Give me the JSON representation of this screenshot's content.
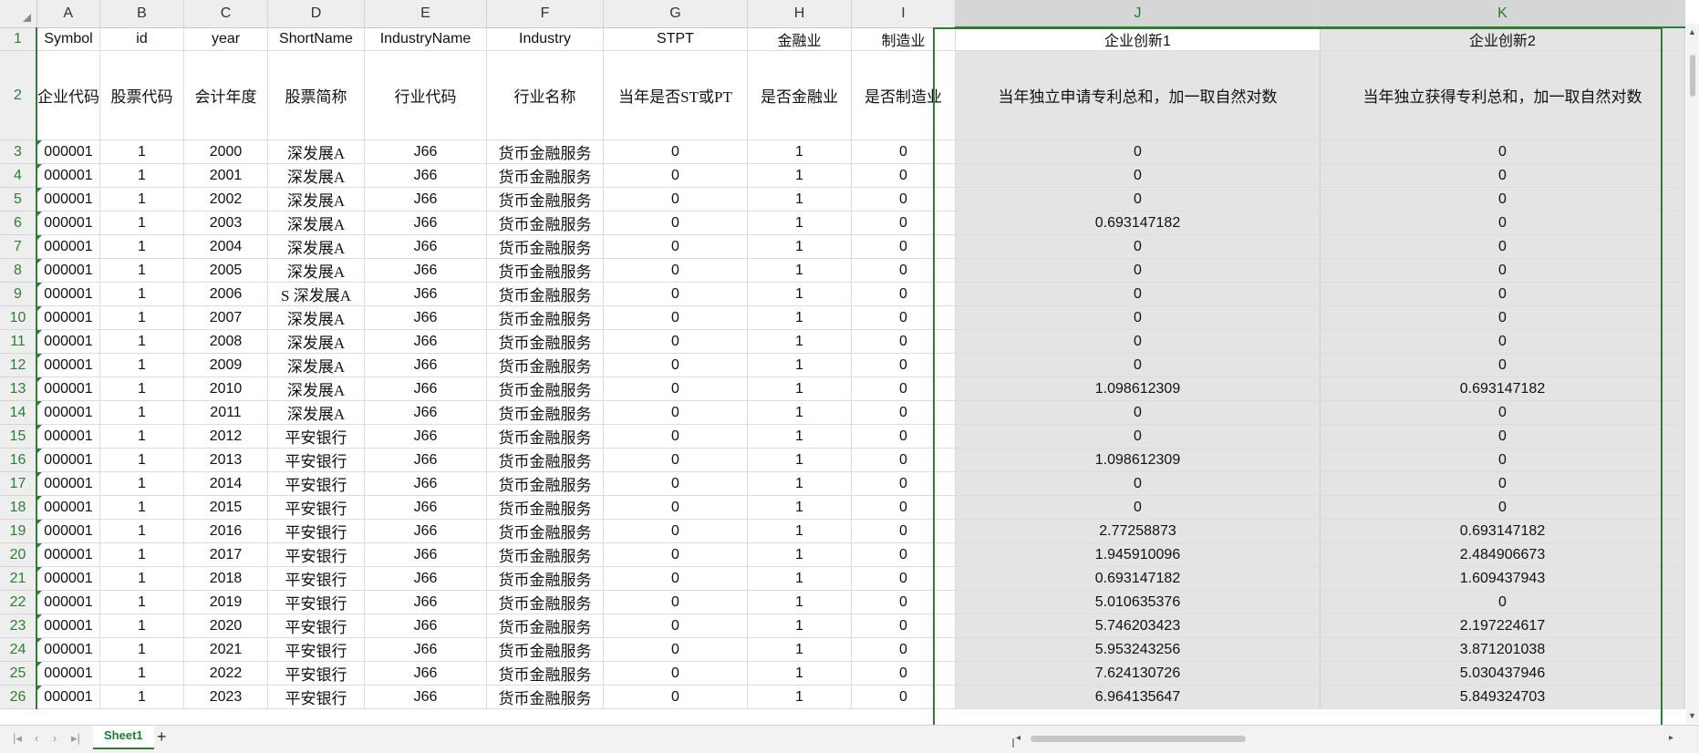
{
  "sheet_tabs": [
    {
      "label": "Sheet1",
      "active": true
    }
  ],
  "add_sheet_label": "+",
  "column_headers": [
    "A",
    "B",
    "C",
    "D",
    "E",
    "F",
    "G",
    "H",
    "I",
    "J",
    "K"
  ],
  "selected_columns": [
    "J",
    "K"
  ],
  "header_row1": [
    "Symbol",
    "id",
    "year",
    "ShortName",
    "IndustryName",
    "Industry",
    "STPT",
    "金融业",
    "制造业",
    "企业创新1",
    "企业创新2"
  ],
  "header_row2": [
    "企业代码",
    "股票代码",
    "会计年度",
    "股票简称",
    "行业代码",
    "行业名称",
    "当年是否ST或PT",
    "是否金融业",
    "是否制造业",
    "当年独立申请专利总和，加一取自然对数",
    "当年独立获得专利总和，加一取自然对数"
  ],
  "rows": [
    [
      "000001",
      "1",
      "2000",
      "深发展A",
      "J66",
      "货币金融服务",
      "0",
      "1",
      "0",
      "0",
      "0"
    ],
    [
      "000001",
      "1",
      "2001",
      "深发展A",
      "J66",
      "货币金融服务",
      "0",
      "1",
      "0",
      "0",
      "0"
    ],
    [
      "000001",
      "1",
      "2002",
      "深发展A",
      "J66",
      "货币金融服务",
      "0",
      "1",
      "0",
      "0",
      "0"
    ],
    [
      "000001",
      "1",
      "2003",
      "深发展A",
      "J66",
      "货币金融服务",
      "0",
      "1",
      "0",
      "0.693147182",
      "0"
    ],
    [
      "000001",
      "1",
      "2004",
      "深发展A",
      "J66",
      "货币金融服务",
      "0",
      "1",
      "0",
      "0",
      "0"
    ],
    [
      "000001",
      "1",
      "2005",
      "深发展A",
      "J66",
      "货币金融服务",
      "0",
      "1",
      "0",
      "0",
      "0"
    ],
    [
      "000001",
      "1",
      "2006",
      "S 深发展A",
      "J66",
      "货币金融服务",
      "0",
      "1",
      "0",
      "0",
      "0"
    ],
    [
      "000001",
      "1",
      "2007",
      "深发展A",
      "J66",
      "货币金融服务",
      "0",
      "1",
      "0",
      "0",
      "0"
    ],
    [
      "000001",
      "1",
      "2008",
      "深发展A",
      "J66",
      "货币金融服务",
      "0",
      "1",
      "0",
      "0",
      "0"
    ],
    [
      "000001",
      "1",
      "2009",
      "深发展A",
      "J66",
      "货币金融服务",
      "0",
      "1",
      "0",
      "0",
      "0"
    ],
    [
      "000001",
      "1",
      "2010",
      "深发展A",
      "J66",
      "货币金融服务",
      "0",
      "1",
      "0",
      "1.098612309",
      "0.693147182"
    ],
    [
      "000001",
      "1",
      "2011",
      "深发展A",
      "J66",
      "货币金融服务",
      "0",
      "1",
      "0",
      "0",
      "0"
    ],
    [
      "000001",
      "1",
      "2012",
      "平安银行",
      "J66",
      "货币金融服务",
      "0",
      "1",
      "0",
      "0",
      "0"
    ],
    [
      "000001",
      "1",
      "2013",
      "平安银行",
      "J66",
      "货币金融服务",
      "0",
      "1",
      "0",
      "1.098612309",
      "0"
    ],
    [
      "000001",
      "1",
      "2014",
      "平安银行",
      "J66",
      "货币金融服务",
      "0",
      "1",
      "0",
      "0",
      "0"
    ],
    [
      "000001",
      "1",
      "2015",
      "平安银行",
      "J66",
      "货币金融服务",
      "0",
      "1",
      "0",
      "0",
      "0"
    ],
    [
      "000001",
      "1",
      "2016",
      "平安银行",
      "J66",
      "货币金融服务",
      "0",
      "1",
      "0",
      "2.77258873",
      "0.693147182"
    ],
    [
      "000001",
      "1",
      "2017",
      "平安银行",
      "J66",
      "货币金融服务",
      "0",
      "1",
      "0",
      "1.945910096",
      "2.484906673"
    ],
    [
      "000001",
      "1",
      "2018",
      "平安银行",
      "J66",
      "货币金融服务",
      "0",
      "1",
      "0",
      "0.693147182",
      "1.609437943"
    ],
    [
      "000001",
      "1",
      "2019",
      "平安银行",
      "J66",
      "货币金融服务",
      "0",
      "1",
      "0",
      "5.010635376",
      "0"
    ],
    [
      "000001",
      "1",
      "2020",
      "平安银行",
      "J66",
      "货币金融服务",
      "0",
      "1",
      "0",
      "5.746203423",
      "2.197224617"
    ],
    [
      "000001",
      "1",
      "2021",
      "平安银行",
      "J66",
      "货币金融服务",
      "0",
      "1",
      "0",
      "5.953243256",
      "3.871201038"
    ],
    [
      "000001",
      "1",
      "2022",
      "平安银行",
      "J66",
      "货币金融服务",
      "0",
      "1",
      "0",
      "7.624130726",
      "5.030437946"
    ],
    [
      "000001",
      "1",
      "2023",
      "平安银行",
      "J66",
      "货币金融服务",
      "0",
      "1",
      "0",
      "6.964135647",
      "5.849324703"
    ]
  ],
  "colors": {
    "accent": "#2e7d32",
    "header_bg": "#eeeeee",
    "selection_bg": "#e4e4e4"
  },
  "icons": {
    "nav_first": "first-sheet-icon",
    "nav_prev": "prev-sheet-icon",
    "nav_next": "next-sheet-icon",
    "nav_last": "last-sheet-icon"
  }
}
